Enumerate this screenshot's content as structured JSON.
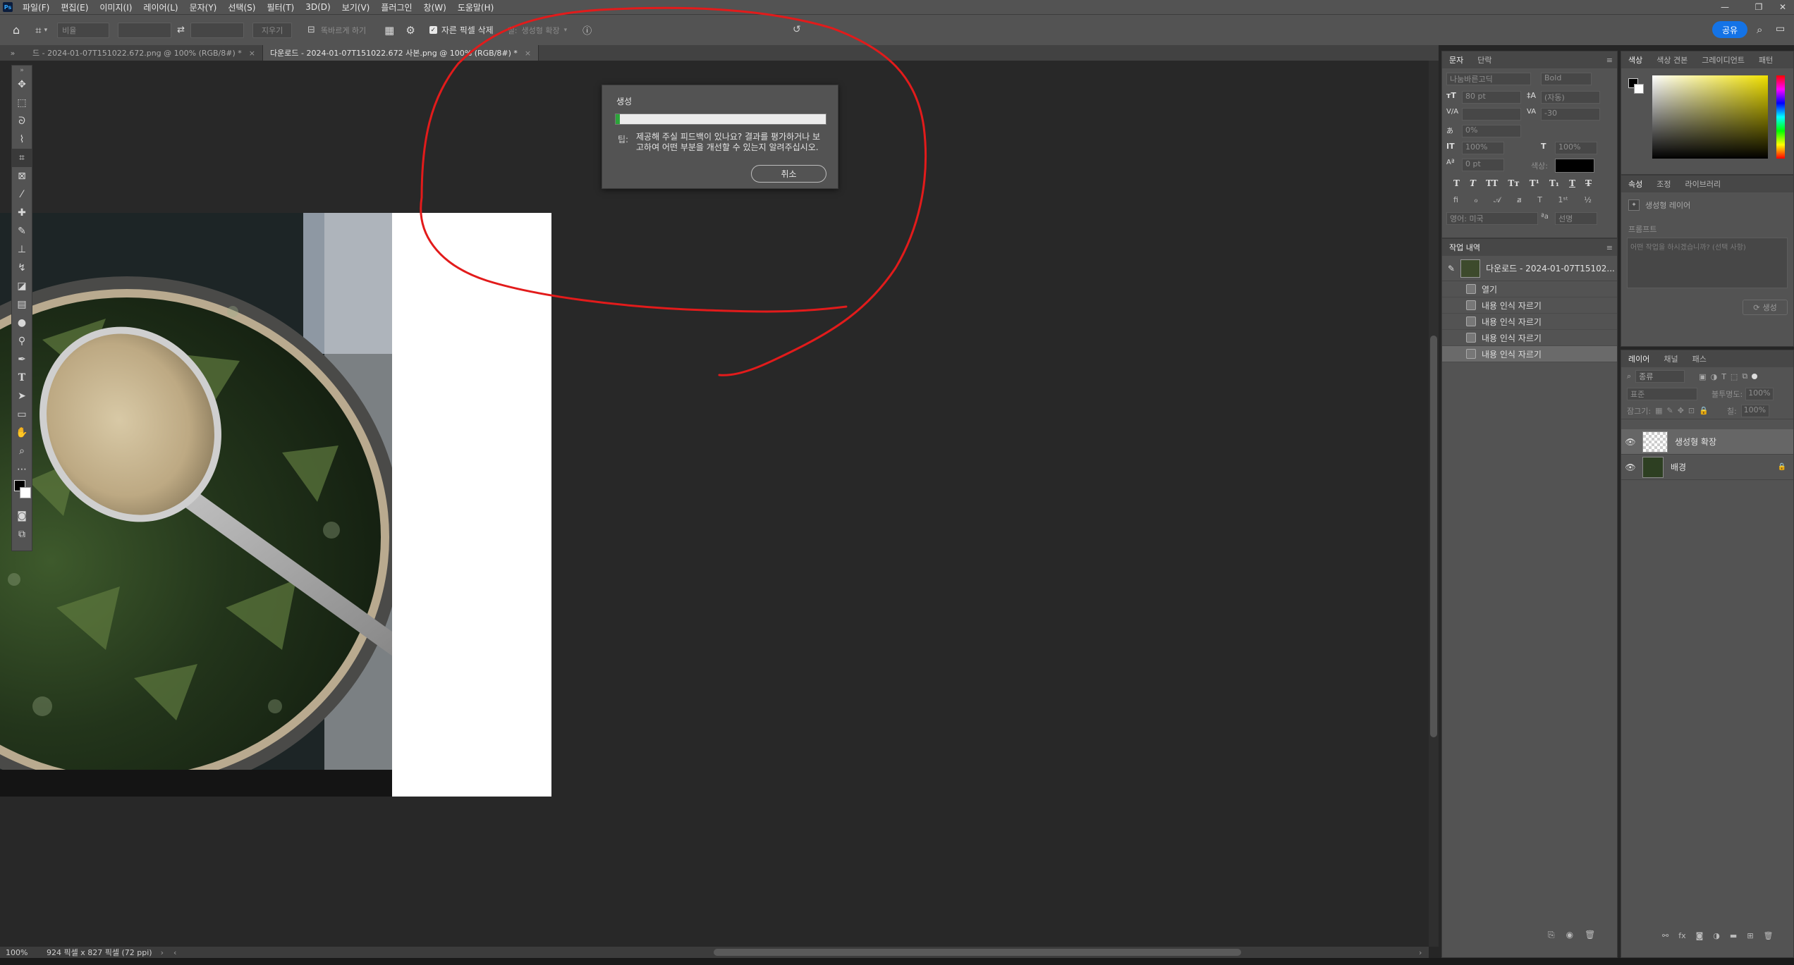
{
  "app": {
    "logo": "Ps"
  },
  "menubar": {
    "items": [
      "파일(F)",
      "편집(E)",
      "이미지(I)",
      "레이어(L)",
      "문자(Y)",
      "선택(S)",
      "필터(T)",
      "3D(D)",
      "보기(V)",
      "플러그인",
      "창(W)",
      "도움말(H)"
    ]
  },
  "optionsbar": {
    "ratio_placeholder": "비율",
    "clear_label": "지우기",
    "straighten_label": "똑바르게 하기",
    "delete_pixels_label": "자른 픽셀 삭제",
    "fill_label": "칠:",
    "fill_value": "생성형 확장",
    "share_label": "공유"
  },
  "tabs": [
    {
      "label": "드 - 2024-01-07T151022.672.png @ 100% (RGB/8#) *",
      "active": false
    },
    {
      "label": "다운로드 - 2024-01-07T151022.672 사본.png @ 100% (RGB/8#) *",
      "active": true
    }
  ],
  "dialog": {
    "title": "생성",
    "progress": 0.02,
    "hint_icon_label": "팁:",
    "hint_text": "제공해 주실 피드백이 있나요? 결과를 평가하거나 보고하여 어떤 부분을 개선할 수 있는지 알려주십시오.",
    "cancel_label": "취소"
  },
  "statusbar": {
    "zoom": "100%",
    "doc_info": "924 픽셀 x 827 픽셀 (72 ppi)"
  },
  "character_panel": {
    "tabs": [
      "문자",
      "단락"
    ],
    "font_family": "나눔바른고딕",
    "font_style": "Bold",
    "font_size": "80 pt",
    "leading": "(자동)",
    "kerning": "",
    "tracking": "-30",
    "tsume": "0%",
    "vscale": "100%",
    "hscale": "100%",
    "baseline": "0 pt",
    "color_label": "색상:",
    "language": "영어: 미국",
    "antialias": "선명"
  },
  "history_panel": {
    "tab": "작업 내역",
    "snapshot": "다운로드 - 2024-01-07T15102...",
    "items": [
      "열기",
      "내용 인식 자르기",
      "내용 인식 자르기",
      "내용 인식 자르기",
      "내용 인식 자르기"
    ],
    "selected_index": 4
  },
  "color_panel": {
    "tabs": [
      "색상",
      "색상 견본",
      "그레이디언트",
      "패턴"
    ],
    "hue_color": "#f0e000"
  },
  "properties_panel": {
    "tabs": [
      "속성",
      "조정",
      "라이브러리"
    ],
    "type_label": "생성형 레이어",
    "prompt_label": "프롬프트",
    "prompt_placeholder": "어떤 작업을 하시겠습니까? (선택 사항)",
    "generate_label": "생성"
  },
  "layers_panel": {
    "tabs": [
      "레이어",
      "채널",
      "패스"
    ],
    "filter_label": "종류",
    "blend_mode": "표준",
    "opacity_label": "불투명도:",
    "opacity_value": "100%",
    "lock_label": "잠그기:",
    "fill_label": "칠:",
    "fill_value": "100%",
    "layers": [
      {
        "name": "생성형 확장",
        "selected": true,
        "locked": false
      },
      {
        "name": "배경",
        "selected": false,
        "locked": true
      }
    ]
  },
  "colors": {
    "accent": "#1473e6",
    "annotation": "#e21b1b",
    "progress": "#2ca43a"
  }
}
